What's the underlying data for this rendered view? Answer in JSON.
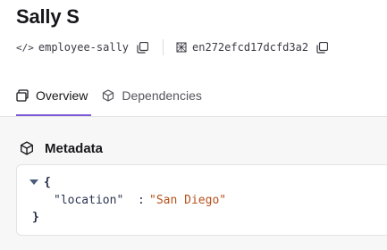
{
  "header": {
    "title": "Sally S",
    "slug": "employee-sally",
    "id": "en272efcd17dcfd3a2"
  },
  "tabs": [
    {
      "label": "Overview",
      "active": true,
      "icon": "window-icon"
    },
    {
      "label": "Dependencies",
      "active": false,
      "icon": "cube-icon"
    }
  ],
  "metadata": {
    "title": "Metadata",
    "icon": "cube-icon",
    "json": {
      "open_brace": "{",
      "close_brace": "}",
      "key": "\"location\"",
      "colon": ":",
      "value": "\"San Diego\""
    }
  },
  "colors": {
    "accent": "#7c5cd6",
    "string_value": "#b5521e"
  }
}
